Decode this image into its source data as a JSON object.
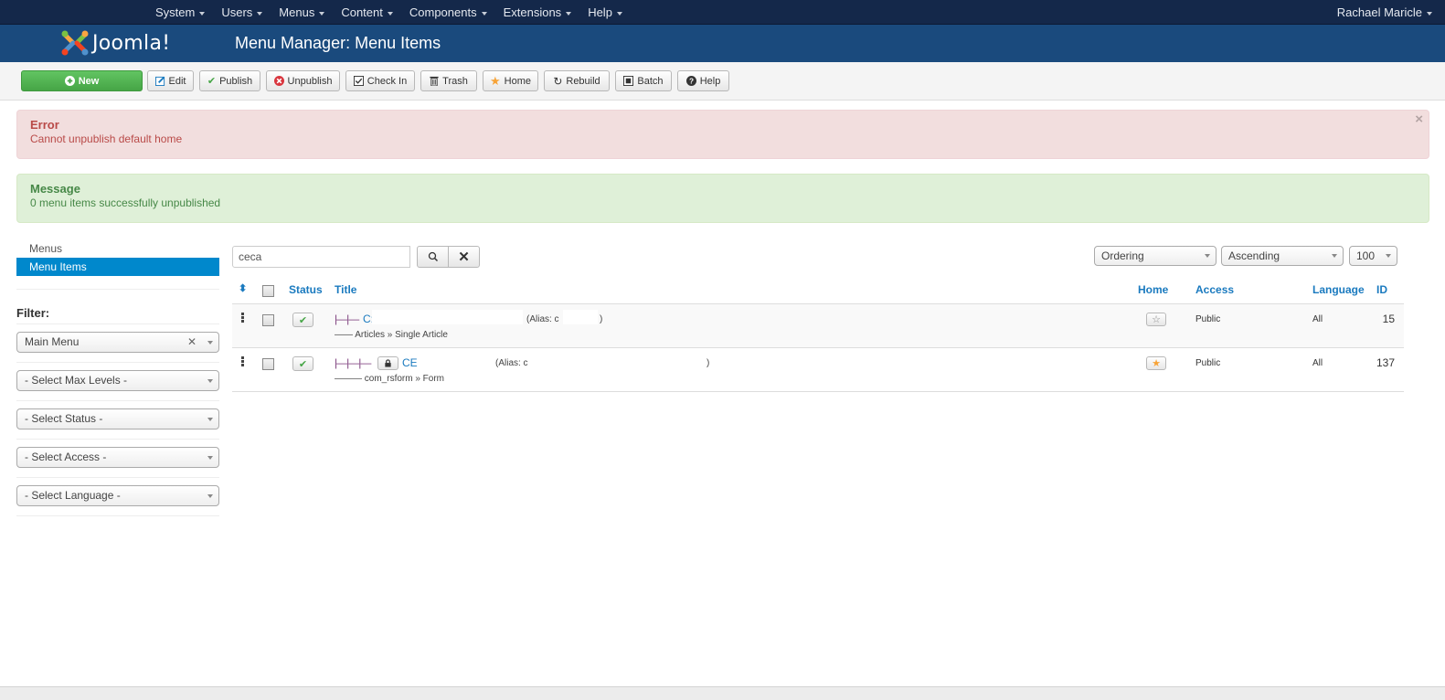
{
  "topnav": {
    "menu": [
      {
        "label": "System"
      },
      {
        "label": "Users"
      },
      {
        "label": "Menus"
      },
      {
        "label": "Content"
      },
      {
        "label": "Components"
      },
      {
        "label": "Extensions"
      },
      {
        "label": "Help"
      }
    ],
    "user": "Rachael Maricle"
  },
  "header": {
    "logo_text": "Joomla!",
    "title": "Menu Manager: Menu Items"
  },
  "toolbar": {
    "buttons": [
      {
        "label": "New",
        "icon": "plus-circle-icon"
      },
      {
        "label": "Edit",
        "icon": "edit-icon"
      },
      {
        "label": "Publish",
        "icon": "check-icon"
      },
      {
        "label": "Unpublish",
        "icon": "x-circle-icon"
      },
      {
        "label": "Check In",
        "icon": "checkbox-icon"
      },
      {
        "label": "Trash",
        "icon": "trash-icon"
      },
      {
        "label": "Home",
        "icon": "star-icon"
      },
      {
        "label": "Rebuild",
        "icon": "refresh-icon"
      },
      {
        "label": "Batch",
        "icon": "batch-icon"
      },
      {
        "label": "Help",
        "icon": "question-icon"
      }
    ]
  },
  "alerts": {
    "error": {
      "title": "Error",
      "text": "Cannot unpublish default home",
      "close": "×",
      "color": "#b94a48"
    },
    "message": {
      "title": "Message",
      "text": "0 menu items successfully unpublished",
      "color": "#468847"
    }
  },
  "sidebar": {
    "links": [
      {
        "label": "Menus",
        "active": false
      },
      {
        "label": "Menu Items",
        "active": true
      }
    ],
    "filter_label": "Filter:",
    "filters": [
      {
        "value": "Main Menu",
        "clearable": true
      },
      {
        "value": "- Select Max Levels -"
      },
      {
        "value": "- Select Status -"
      },
      {
        "value": "- Select Access -"
      },
      {
        "value": "- Select Language -"
      }
    ]
  },
  "search": {
    "value": "ceca",
    "clear_label": "✕"
  },
  "list_controls": {
    "order_by": "Ordering",
    "direction": "Ascending",
    "limit": "100"
  },
  "table": {
    "columns": {
      "status": "Status",
      "title": "Title",
      "home": "Home",
      "access": "Access",
      "language": "Language",
      "id": "ID"
    },
    "rows": [
      {
        "tree": "|—|—",
        "title": "C:",
        "alias_prefix": "(Alias: c",
        "alias_suffix": ")",
        "sub_tree": "——",
        "type": "Articles » Single Article",
        "published": true,
        "locked": false,
        "home": false,
        "access": "Public",
        "language": "All",
        "id": "15"
      },
      {
        "tree": "|—|—|—",
        "title": "CE",
        "alias_prefix": "(Alias: c",
        "alias_suffix": ")",
        "sub_tree": "———",
        "type": "com_rsform » Form",
        "published": true,
        "locked": true,
        "home": true,
        "access": "Public",
        "language": "All",
        "id": "137"
      }
    ]
  },
  "colors": {
    "topnav": "#14284a",
    "header": "#1a4a7d",
    "accent": "#0088cc",
    "link": "#1a7abf",
    "new_button": "#46a546",
    "home_star": "#f7a337"
  }
}
